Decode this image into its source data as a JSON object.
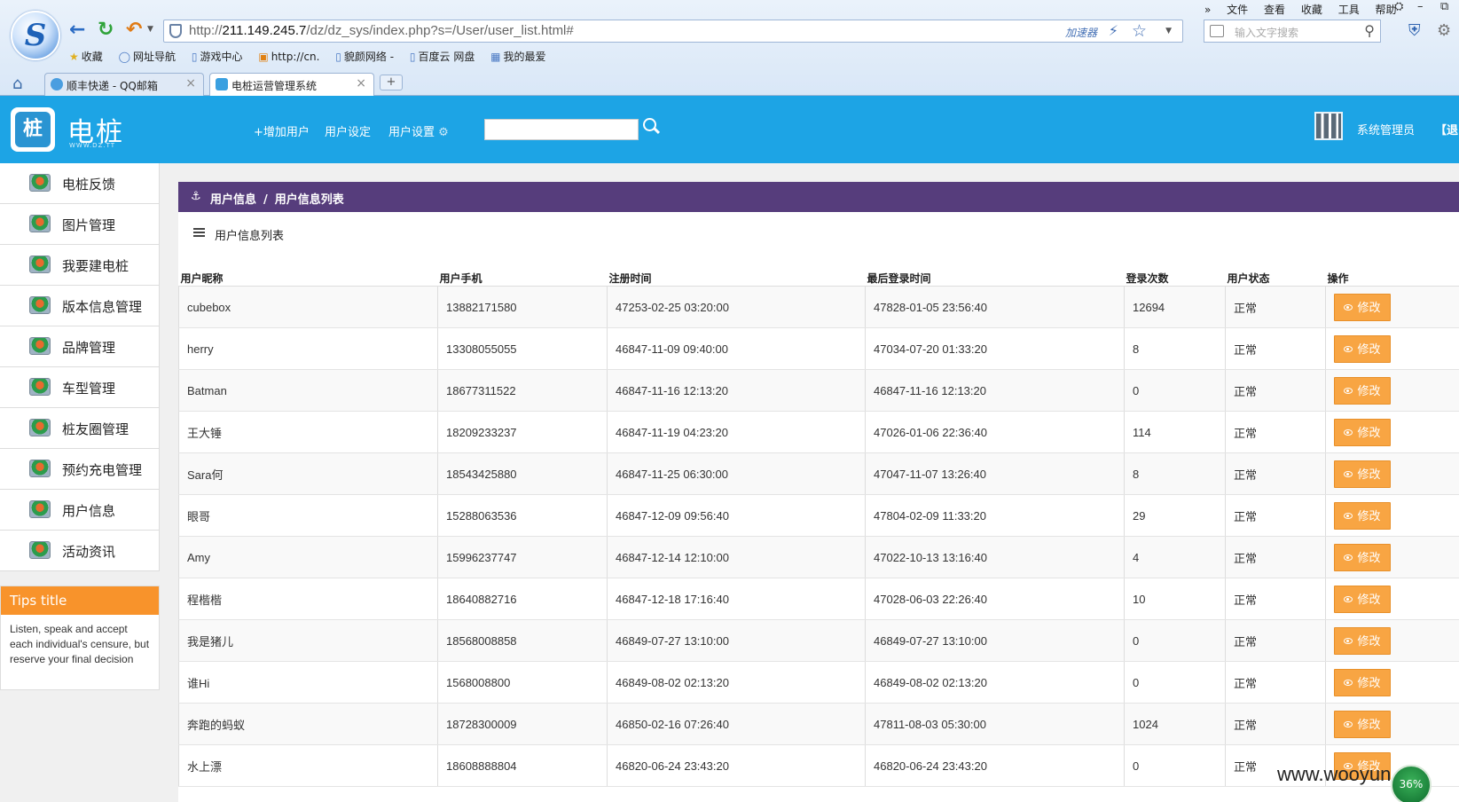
{
  "browser": {
    "url_prefix": "http://",
    "url_host": "211.149.245.7",
    "url_path": "/dz/dz_sys/index.php?s=/User/user_list.html#",
    "accelerator_label": "加速器",
    "search_placeholder": "输入文字搜索",
    "menu": [
      "文件",
      "查看",
      "收藏",
      "工具",
      "帮助"
    ],
    "bookmarks": [
      "收藏",
      "网址导航",
      "游戏中心",
      "http://cn.",
      "貌颜网络 -",
      "百度云 网盘",
      "我的最爱"
    ],
    "tabs": [
      {
        "title": "顺丰快递 - QQ邮箱"
      },
      {
        "title": "电桩运营管理系统"
      }
    ],
    "new_tab_label": "+"
  },
  "app": {
    "logo_char": "桩",
    "name": "电桩",
    "name_sub": "WWW.DZ.TT",
    "nav": {
      "add_user": "+增加用户",
      "user_config": "用户设定",
      "user_settings": "用户设置"
    },
    "admin_name": "系统管理员",
    "logout": "【退出"
  },
  "sidebar": {
    "items": [
      {
        "label": "电桩反馈"
      },
      {
        "label": "图片管理"
      },
      {
        "label": "我要建电桩"
      },
      {
        "label": "版本信息管理"
      },
      {
        "label": "品牌管理"
      },
      {
        "label": "车型管理"
      },
      {
        "label": "桩友圈管理"
      },
      {
        "label": "预约充电管理"
      },
      {
        "label": "用户信息"
      },
      {
        "label": "活动资讯"
      }
    ],
    "tips": {
      "title": "Tips title",
      "body": "Listen, speak and accept each individual's censure, but reserve your final decision"
    }
  },
  "main": {
    "breadcrumb": {
      "root": "用户信息",
      "separator": "/",
      "current": "用户信息列表"
    },
    "panel_title": "用户信息列表",
    "columns": [
      "用户昵称",
      "用户手机",
      "注册时间",
      "最后登录时间",
      "登录次数",
      "用户状态",
      "操作"
    ],
    "edit_label": "修改",
    "rows": [
      {
        "nick": "cubebox",
        "phone": "13882171580",
        "reg": "47253-02-25 03:20:00",
        "last": "47828-01-05 23:56:40",
        "count": "12694",
        "status": "正常"
      },
      {
        "nick": "herry",
        "phone": "13308055055",
        "reg": "46847-11-09 09:40:00",
        "last": "47034-07-20 01:33:20",
        "count": "8",
        "status": "正常"
      },
      {
        "nick": "Batman",
        "phone": "18677311522",
        "reg": "46847-11-16 12:13:20",
        "last": "46847-11-16 12:13:20",
        "count": "0",
        "status": "正常"
      },
      {
        "nick": "王大锤",
        "phone": "18209233237",
        "reg": "46847-11-19 04:23:20",
        "last": "47026-01-06 22:36:40",
        "count": "114",
        "status": "正常"
      },
      {
        "nick": "Sara何",
        "phone": "18543425880",
        "reg": "46847-11-25 06:30:00",
        "last": "47047-11-07 13:26:40",
        "count": "8",
        "status": "正常"
      },
      {
        "nick": "眼哥",
        "phone": "15288063536",
        "reg": "46847-12-09 09:56:40",
        "last": "47804-02-09 11:33:20",
        "count": "29",
        "status": "正常"
      },
      {
        "nick": "Amy",
        "phone": "15996237747",
        "reg": "46847-12-14 12:10:00",
        "last": "47022-10-13 13:16:40",
        "count": "4",
        "status": "正常"
      },
      {
        "nick": "程楷楷",
        "phone": "18640882716",
        "reg": "46847-12-18 17:16:40",
        "last": "47028-06-03 22:26:40",
        "count": "10",
        "status": "正常"
      },
      {
        "nick": "我是猪儿",
        "phone": "18568008858",
        "reg": "46849-07-27 13:10:00",
        "last": "46849-07-27 13:10:00",
        "count": "0",
        "status": "正常"
      },
      {
        "nick": "谁Hi",
        "phone": "1568008800",
        "reg": "46849-08-02 02:13:20",
        "last": "46849-08-02 02:13:20",
        "count": "0",
        "status": "正常"
      },
      {
        "nick": "奔跑的蚂蚁",
        "phone": "18728300009",
        "reg": "46850-02-16 07:26:40",
        "last": "47811-08-03 05:30:00",
        "count": "1024",
        "status": "正常"
      },
      {
        "nick": "水上漂",
        "phone": "18608888804",
        "reg": "46820-06-24 23:43:20",
        "last": "46820-06-24 23:43:20",
        "count": "0",
        "status": "正常"
      }
    ]
  },
  "overlay": {
    "watermark": "www.wooyun.org",
    "speed_badge": "36%"
  }
}
